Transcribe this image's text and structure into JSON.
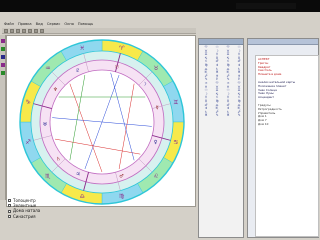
{
  "menu": [
    "Файл",
    "Правка",
    "Вид",
    "Сервис",
    "Окно",
    "Помощь"
  ],
  "legend": {
    "items": [
      "Топоцентр",
      "Зелентные",
      "Дома натала",
      "Синастрия"
    ]
  },
  "zodiac_signs": [
    "♈",
    "♉",
    "♊",
    "♋",
    "♌",
    "♍",
    "♎",
    "♏",
    "♐",
    "♑",
    "♒",
    "♓"
  ],
  "planet_glyphs": [
    "☉",
    "☽",
    "☿",
    "♀",
    "♂",
    "♃",
    "♄",
    "♅",
    "♆",
    "♇"
  ],
  "table_glyphs_col1": [
    "♈",
    "♉",
    "♊",
    "♋",
    "♌",
    "♍",
    "♎",
    "♏",
    "♐",
    "♑",
    "♒",
    "♓",
    "☉",
    "☽",
    "☿",
    "♀",
    "♂",
    "♃",
    "♄",
    "♅"
  ],
  "table_glyphs_col2": [
    "☉",
    "☽",
    "☿",
    "♀",
    "♂",
    "♃",
    "♄",
    "♅",
    "♆",
    "♇",
    "♈",
    "♉",
    "♊",
    "♋",
    "♌",
    "♍",
    "♎",
    "♏",
    "♐",
    "♑"
  ],
  "right_panel": {
    "lines_top": [
      "АСПЕКТ",
      "Тригон",
      "Квадрат",
      "Секстиль",
      "Планета в доме"
    ],
    "lines_mid": [
      "Анализ натальной карты",
      "Положение планет",
      "Знак Солнца",
      "Знак Луны",
      "Асцендент"
    ],
    "lines_bottom": [
      "Градусы",
      "Ретроградность",
      "Управитель",
      "Дом 1",
      "Дом 7",
      "Дом 10"
    ]
  }
}
